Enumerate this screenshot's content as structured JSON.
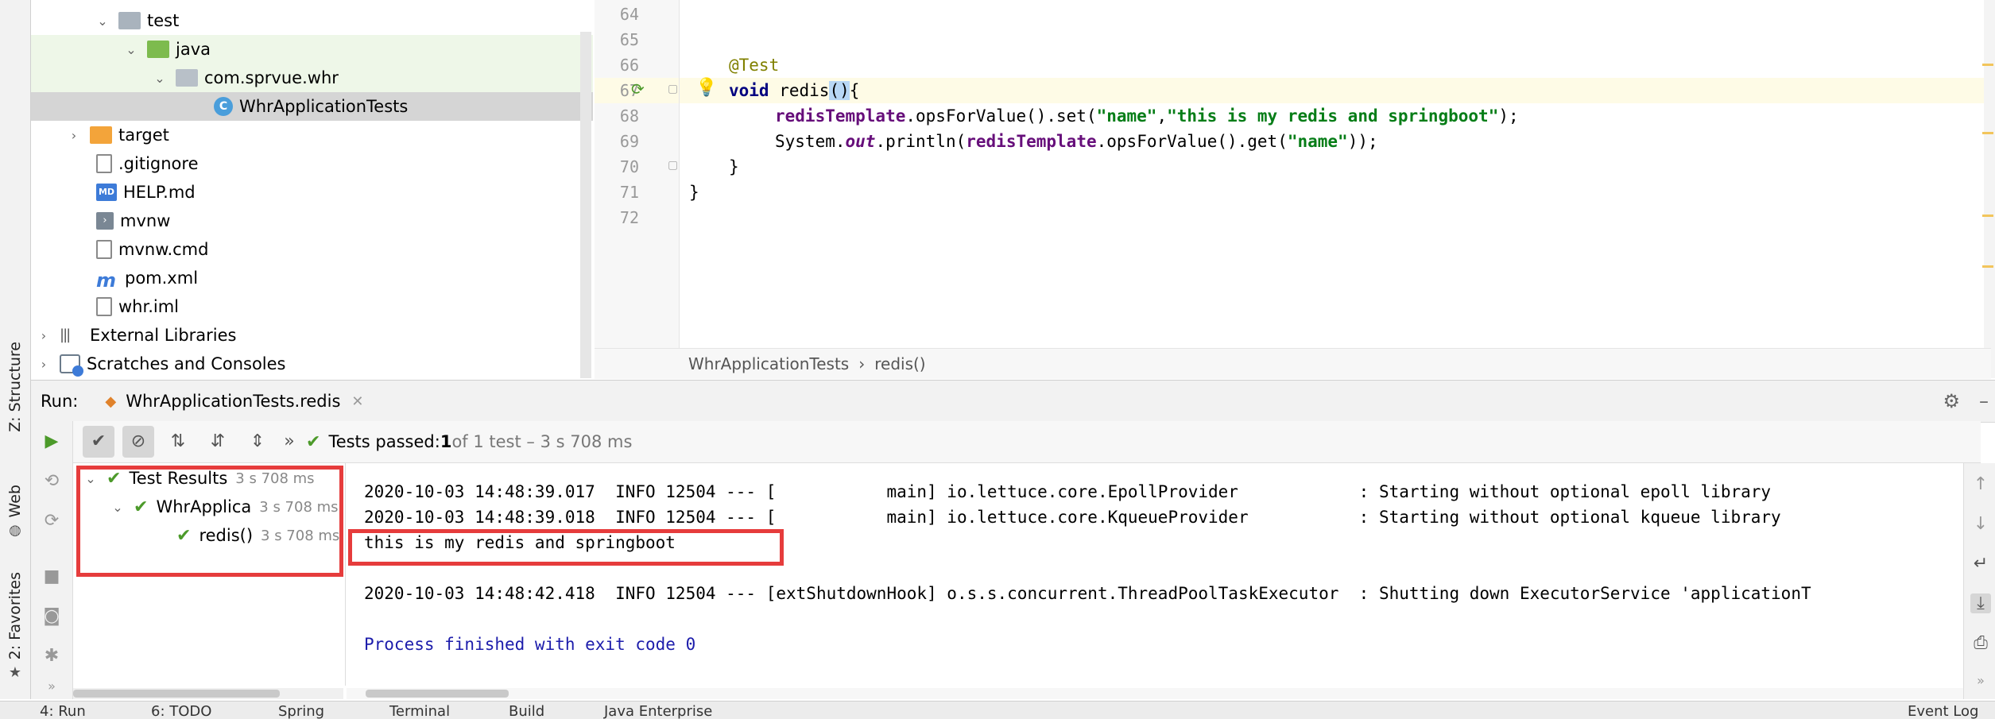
{
  "left_strip": {
    "structure_tab": "Z: Structure",
    "web_tab": "Web",
    "favorites_tab": "2: Favorites"
  },
  "project_tree": {
    "items": [
      {
        "label": "test",
        "icon": "folder-icon"
      },
      {
        "label": "java",
        "icon": "source-folder-icon"
      },
      {
        "label": "com.sprvue.whr",
        "icon": "package-icon"
      },
      {
        "label": "WhrApplicationTests",
        "icon": "test-class-icon"
      },
      {
        "label": "target",
        "icon": "excluded-folder-icon"
      },
      {
        "label": ".gitignore",
        "icon": "file-icon"
      },
      {
        "label": "HELP.md",
        "icon": "markdown-icon"
      },
      {
        "label": "mvnw",
        "icon": "shell-icon"
      },
      {
        "label": "mvnw.cmd",
        "icon": "file-icon"
      },
      {
        "label": "pom.xml",
        "icon": "maven-icon"
      },
      {
        "label": "whr.iml",
        "icon": "iml-icon"
      },
      {
        "label": "External Libraries",
        "icon": "library-icon"
      },
      {
        "label": "Scratches and Consoles",
        "icon": "scratches-icon"
      }
    ]
  },
  "editor": {
    "line_numbers": [
      "64",
      "65",
      "66",
      "67",
      "68",
      "69",
      "70",
      "71",
      "72"
    ],
    "code": {
      "annotation": "@Test",
      "kw_void": "void",
      "method_decl": " redis",
      "paren_open": "(",
      "paren_close": ")",
      "brace_open": "{",
      "field1": "redisTemplate",
      "call1a": ".opsForValue().set(",
      "str_name1": "\"name\"",
      "comma": ",",
      "str_value": "\"this is my redis and springboot\"",
      "end1": ");",
      "sys": "System.",
      "out": "out",
      "println": ".println(",
      "field2": "redisTemplate",
      "call2": ".opsForValue().get(",
      "str_name2": "\"name\"",
      "end2": "));",
      "close_inner": "}",
      "close_outer": "}"
    },
    "breadcrumb": {
      "class": "WhrApplicationTests",
      "sep": "›",
      "method": "redis()"
    }
  },
  "run": {
    "label": "Run:",
    "tab_title": "WhrApplicationTests.redis",
    "status_prefix": "Tests passed: ",
    "status_count": "1",
    "status_suffix": " of 1 test – 3 s 708 ms",
    "more": "»",
    "results": [
      {
        "label": "Test Results",
        "duration": "3 s 708 ms"
      },
      {
        "label": "WhrApplica",
        "duration": "3 s 708 ms"
      },
      {
        "label": "redis()",
        "duration": "3 s 708 ms"
      }
    ],
    "console": [
      "2020-10-03 14:48:39.017  INFO 12504 --- [           main] io.lettuce.core.EpollProvider            : Starting without optional epoll library",
      "2020-10-03 14:48:39.018  INFO 12504 --- [           main] io.lettuce.core.KqueueProvider           : Starting without optional kqueue library",
      "this is my redis and springboot",
      "",
      "2020-10-03 14:48:42.418  INFO 12504 --- [extShutdownHook] o.s.s.concurrent.ThreadPoolTaskExecutor  : Shutting down ExecutorService 'applicationT",
      "",
      "Process finished with exit code 0"
    ]
  },
  "bottom_bar": {
    "tabs": [
      "4: Run",
      "6: TODO",
      "Spring",
      "Terminal",
      "Build",
      "Java Enterprise"
    ],
    "event_log": "Event Log"
  },
  "colors": {
    "highlight_box": "#e63c3c",
    "pass_green": "#4c9a2a"
  }
}
